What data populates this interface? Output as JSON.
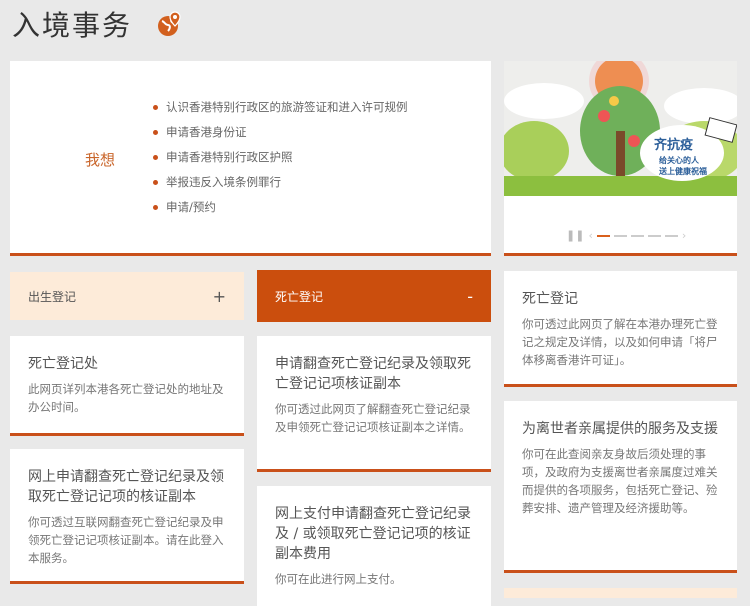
{
  "header": {
    "title": "入境事务",
    "icon": "globe-pin-icon"
  },
  "want": {
    "label": "我想",
    "items": [
      "认识香港特别行政区的旅游签证和进入许可规例",
      "申请香港身份证",
      "申请香港特别行政区护照",
      "举报违反入境条例罪行",
      "申请/预约"
    ]
  },
  "banner": {
    "headline": "齐抗疫",
    "line1": "给关心的人",
    "line2": "送上健康祝福",
    "slides": 5,
    "active_slide": 1
  },
  "accordions": [
    {
      "label": "出生登记",
      "toggle": "+",
      "expanded": false
    },
    {
      "label": "死亡登记",
      "toggle": "-",
      "expanded": true
    }
  ],
  "cards": [
    {
      "title": "死亡登记处",
      "desc": "此网页详列本港各死亡登记处的地址及办公时间。"
    },
    {
      "title": "网上申请翻查死亡登记纪录及领取死亡登记记项的核证副本",
      "desc": "你可透过互联网翻查死亡登记纪录及申领死亡登记记项核证副本。请在此登入本服务。"
    },
    {
      "title": "申请翻查死亡登记纪录及领取死亡登记记项核证副本",
      "desc": "你可透过此网页了解翻查死亡登记纪录及申领死亡登记记项核证副本之详情。"
    },
    {
      "title": "网上支付申请翻查死亡登记纪录及 / 或领取死亡登记记项的核证副本费用",
      "desc": "你可在此进行网上支付。"
    },
    {
      "title": "死亡登记",
      "desc": "你可透过此网页了解在本港办理死亡登记之规定及详情，以及如何申请「将尸体移离香港许可证」。"
    },
    {
      "title": "为离世者亲属提供的服务及支援",
      "desc": "你可在此查阅亲友身故后须处理的事项，及政府为支援离世者亲属度过难关而提供的各项服务，包括死亡登记、殓葬安排、遗产管理及经济援助等。"
    }
  ],
  "colors": {
    "accent": "#cb4e0d",
    "peach": "#fdebd9",
    "background": "#e9e9e9"
  }
}
